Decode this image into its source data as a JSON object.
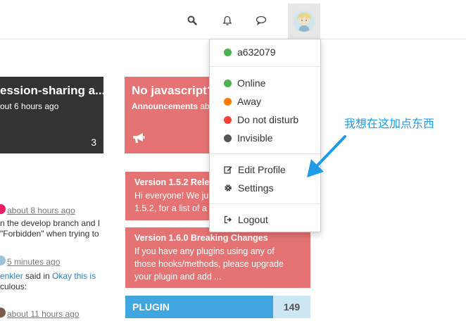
{
  "navbar": {
    "icons": [
      "search-icon",
      "bell-icon",
      "chat-icon",
      "user-avatar"
    ]
  },
  "categories": {
    "dark": {
      "title": "ession-sharing a...",
      "subtitle": "out 6 hours ago",
      "count": "3"
    },
    "red": {
      "title": "No javascript?",
      "sub_bold": "Announcements",
      "sub_rest": "abo",
      "icon": "megaphone-icon",
      "color": "#e57373"
    }
  },
  "topics": [
    {
      "title": "Version 1.5.2 Rele",
      "body_lines": [
        "Hi everyone! We ju",
        "1.5.2, for a list of a"
      ]
    },
    {
      "title": "Version 1.6.0 Breaking Changes",
      "body_lines": [
        "If you have any plugins using any of",
        "those hooks/methods, please upgrade",
        "your plugin and add ..."
      ]
    }
  ],
  "plugin": {
    "label": "PLUGIN",
    "count": "149",
    "color": "#40a6e0"
  },
  "recent_posts": [
    {
      "time": "about 8 hours ago",
      "line1": "n the develop branch and I",
      "line2": "\"Forbidden\" when trying to"
    },
    {
      "time": "5 minutes ago",
      "author": "enkler",
      "said": " said in ",
      "thread": "Okay this is",
      "line2": "culous:"
    },
    {
      "time": "about 11 hours ago"
    }
  ],
  "dropdown": {
    "username": "a632079",
    "statuses": [
      {
        "label": "Online",
        "color": "#4caf50"
      },
      {
        "label": "Away",
        "color": "#ff7a00"
      },
      {
        "label": "Do not disturb",
        "color": "#f44336"
      },
      {
        "label": "Invisible",
        "color": "#555555"
      }
    ],
    "edit_profile": "Edit Profile",
    "settings": "Settings",
    "logout": "Logout"
  },
  "annotation": {
    "text": "我想在这加点东西",
    "color": "#1e9be8"
  }
}
